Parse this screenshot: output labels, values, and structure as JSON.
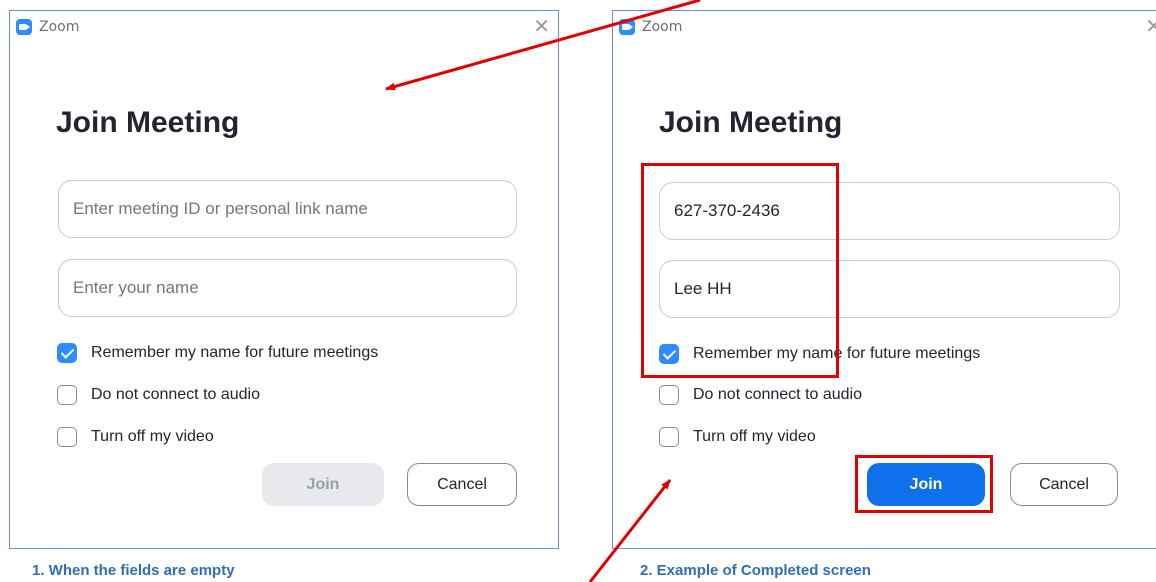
{
  "windows": [
    {
      "title": "Zoom",
      "heading": "Join Meeting",
      "meeting_id_placeholder": "Enter meeting ID or personal link name",
      "name_placeholder": "Enter your name",
      "options": [
        {
          "label": "Remember my name for future meetings",
          "checked": true
        },
        {
          "label": "Do not connect to audio",
          "checked": false
        },
        {
          "label": "Turn off my video",
          "checked": false
        }
      ],
      "join_label": "Join",
      "cancel_label": "Cancel",
      "close_glyph": "✕"
    },
    {
      "title": "Zoom",
      "heading": "Join Meeting",
      "meeting_id_value": "627-370-2436",
      "name_value": "Lee HH",
      "options": [
        {
          "label": "Remember my name for future meetings",
          "checked": true
        },
        {
          "label": "Do not connect to audio",
          "checked": false
        },
        {
          "label": "Turn off my video",
          "checked": false
        }
      ],
      "join_label": "Join",
      "cancel_label": "Cancel",
      "close_glyph": "✕"
    }
  ],
  "captions": {
    "left": "1. When the fields are empty",
    "right": "2. Example of Completed screen"
  },
  "colors": {
    "accent": "#0e71eb",
    "annotation": "#e00000",
    "caption": "#2f6fb5"
  },
  "icons": {
    "app": "zoom-app-icon",
    "close": "close-icon",
    "check": "checkmark-icon"
  }
}
